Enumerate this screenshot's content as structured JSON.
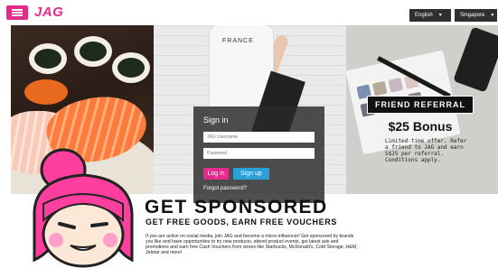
{
  "topbar": {
    "logo": "JAG",
    "language": "English",
    "region": "Singapore"
  },
  "signin": {
    "title": "Sign in",
    "username_placeholder": "JAG Username",
    "password_placeholder": "Password",
    "login_label": "Log in",
    "signup_label": "Sign up",
    "forgot_label": "Forgot password?"
  },
  "referral": {
    "title": "FRIEND REFERRAL",
    "bonus": "$25 Bonus",
    "lines": [
      "Limited-time offer. Refer",
      "a friend to JAG and earn",
      "S$25 per referral.",
      "Conditions apply."
    ]
  },
  "banner": {
    "shirt_text": "FRANCE"
  },
  "promo": {
    "headline": "GET SPONSORED",
    "subhead": "GET FREE GOODS, EARN FREE VOUCHERS",
    "body": "If you are active on social media, join JAG and become a micro-influencer! Get sponsored by brands you like and have opportunities to try new products, attend product events, get latest ads and promotions and earn free Cash Vouchers from stores like Starbucks, McDonald's, Cold Storage, H&M, Jetstar and more!"
  },
  "colors": {
    "brand": "#e62a8b",
    "signup": "#2aa0d6",
    "dark": "#2f2f2f"
  },
  "icons": [
    "menu-icon",
    "caret-down-icon"
  ]
}
